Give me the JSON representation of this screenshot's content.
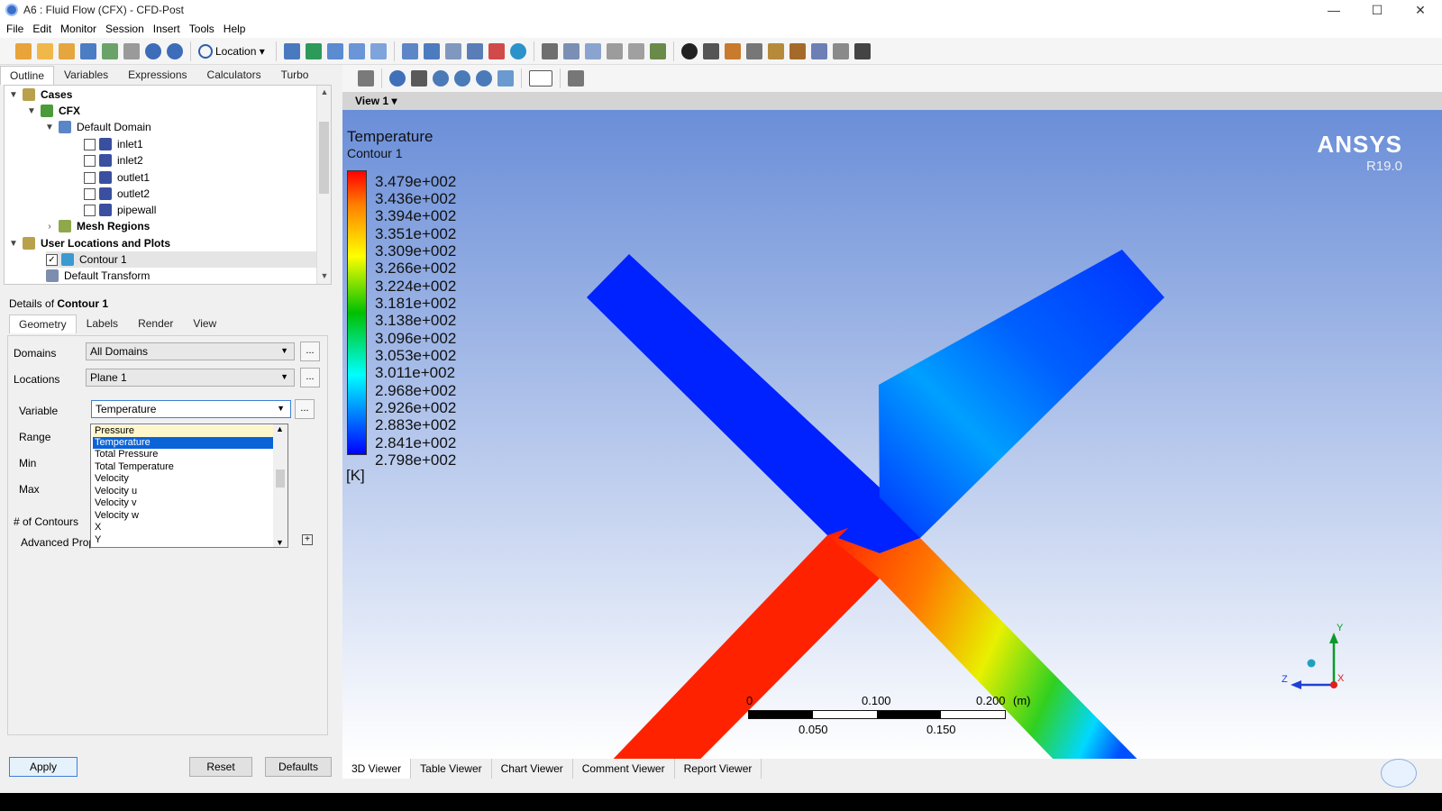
{
  "window": {
    "title": "A6 : Fluid Flow (CFX) - CFD-Post",
    "controls": [
      "—",
      "☐",
      "✕"
    ]
  },
  "menu": [
    "File",
    "Edit",
    "Monitor",
    "Session",
    "Insert",
    "Tools",
    "Help"
  ],
  "toolbar": {
    "location_label": "Location"
  },
  "left_tabs": [
    "Outline",
    "Variables",
    "Expressions",
    "Calculators",
    "Turbo"
  ],
  "tree": {
    "cases": "Cases",
    "cfx": "CFX",
    "default_domain": "Default Domain",
    "boundaries": [
      "inlet1",
      "inlet2",
      "outlet1",
      "outlet2",
      "pipewall"
    ],
    "mesh_regions": "Mesh Regions",
    "user_locations": "User Locations and Plots",
    "contour": "Contour 1",
    "default_transform": "Default Transform"
  },
  "details": {
    "prefix": "Details of ",
    "object": "Contour 1",
    "tabs": [
      "Geometry",
      "Labels",
      "Render",
      "View"
    ],
    "domains_label": "Domains",
    "domains_value": "All Domains",
    "locations_label": "Locations",
    "locations_value": "Plane 1",
    "variable_label": "Variable",
    "variable_value": "Temperature",
    "range_label": "Range",
    "min_label": "Min",
    "max_label": "Max",
    "contours_label": "# of Contours",
    "advanced_label": "Advanced Properties",
    "dots": "..."
  },
  "variable_options": [
    "Pressure",
    "Temperature",
    "Total Pressure",
    "Total Temperature",
    "Velocity",
    "Velocity u",
    "Velocity v",
    "Velocity w",
    "X",
    "Y"
  ],
  "buttons": {
    "apply": "Apply",
    "reset": "Reset",
    "defaults": "Defaults"
  },
  "viewer": {
    "view_label": "View 1",
    "brand": "ANSYS",
    "version": "R19.0",
    "legend_title": "Temperature",
    "legend_subtitle": "Contour 1",
    "legend_values": [
      "3.479e+002",
      "3.436e+002",
      "3.394e+002",
      "3.351e+002",
      "3.309e+002",
      "3.266e+002",
      "3.224e+002",
      "3.181e+002",
      "3.138e+002",
      "3.096e+002",
      "3.053e+002",
      "3.011e+002",
      "2.968e+002",
      "2.926e+002",
      "2.883e+002",
      "2.841e+002",
      "2.798e+002"
    ],
    "unit": "[K]",
    "scale_top": [
      "0",
      "0.100",
      "0.200",
      "(m)"
    ],
    "scale_bottom": [
      "0.050",
      "0.150"
    ],
    "axis_labels": [
      "Y",
      "Z",
      "X"
    ],
    "colors": {
      "hot": "#ff2200",
      "cold": "#0022ff",
      "mid": "#00e0ff"
    }
  },
  "bottom_tabs": [
    "3D Viewer",
    "Table Viewer",
    "Chart Viewer",
    "Comment Viewer",
    "Report Viewer"
  ]
}
